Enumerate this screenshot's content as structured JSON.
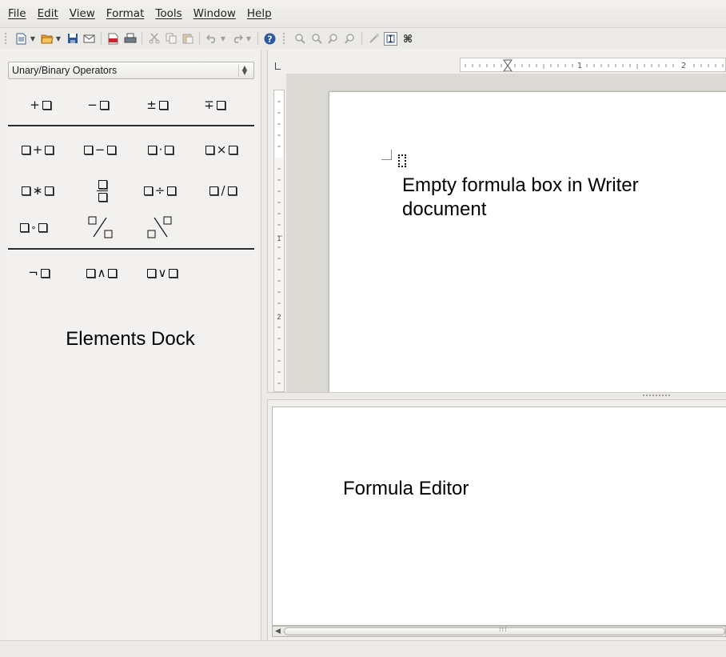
{
  "menu": [
    "File",
    "Edit",
    "View",
    "Format",
    "Tools",
    "Window",
    "Help"
  ],
  "toolbar": {
    "buttons": [
      "new-document-icon",
      "open-folder-icon",
      "save-icon",
      "email-icon",
      "export-pdf-icon",
      "print-icon",
      "cut-icon",
      "copy-icon",
      "paste-icon",
      "undo-icon",
      "redo-icon",
      "help-icon",
      "zoom-in-icon",
      "zoom-out-icon",
      "zoom-100-icon",
      "zoom-page-icon",
      "update-icon",
      "formula-cursor-icon",
      "symbols-icon"
    ]
  },
  "dock": {
    "category": "Unary/Binary Operators",
    "caption": "Elements Dock",
    "groups": [
      [
        "+□",
        "−□",
        "±□",
        "∓□"
      ],
      [
        "□+□",
        "□−□",
        "□·□",
        "□×□",
        "□*□",
        "□ over □",
        "□÷□",
        "□/□",
        "□∘□",
        "□ wideslash □",
        "□ widebslash □"
      ],
      [
        "¬□",
        "□∧□",
        "□∨□"
      ]
    ]
  },
  "document": {
    "caption": "Empty formula box in Writer document"
  },
  "editor": {
    "caption": "Formula Editor"
  },
  "colors": {
    "window_bg": "#f0efed",
    "page": "#ffffff",
    "doc_background": "#dcdad5",
    "accent_blue": "#2c5aa0"
  }
}
